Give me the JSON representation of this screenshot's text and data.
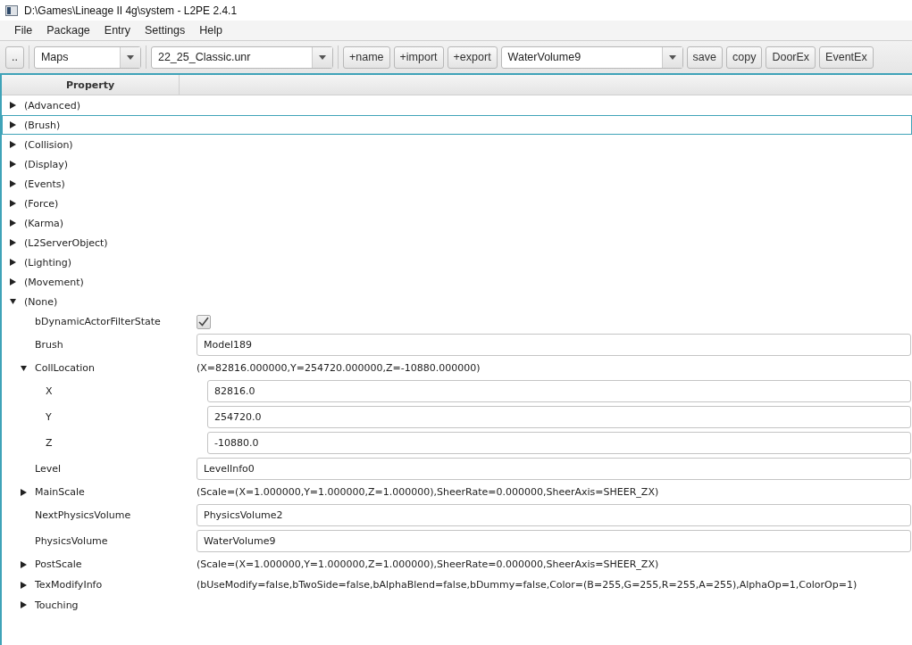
{
  "window": {
    "title": "D:\\Games\\Lineage II 4g\\system - L2PE 2.4.1"
  },
  "menu": [
    "File",
    "Package",
    "Entry",
    "Settings",
    "Help"
  ],
  "toolbar": [
    {
      "kind": "button",
      "label": ".."
    },
    {
      "kind": "separator"
    },
    {
      "kind": "combo",
      "value": "Maps"
    },
    {
      "kind": "separator"
    },
    {
      "kind": "combo",
      "value": "22_25_Classic.unr"
    },
    {
      "kind": "separator"
    },
    {
      "kind": "button",
      "label": "+name"
    },
    {
      "kind": "button",
      "label": "+import"
    },
    {
      "kind": "button",
      "label": "+export"
    },
    {
      "kind": "combo",
      "value": "WaterVolume9"
    },
    {
      "kind": "button",
      "label": "save"
    },
    {
      "kind": "button",
      "label": "copy"
    },
    {
      "kind": "button",
      "label": "DoorEx"
    },
    {
      "kind": "button",
      "label": "EventEx"
    }
  ],
  "table": {
    "columns": [
      "Property"
    ],
    "rows": [
      {
        "label": "(Advanced)",
        "kind": "group",
        "expanded": false,
        "selected": false
      },
      {
        "label": "(Brush)",
        "kind": "group",
        "expanded": false,
        "selected": true
      },
      {
        "label": "(Collision)",
        "kind": "group",
        "expanded": false,
        "selected": false
      },
      {
        "label": "(Display)",
        "kind": "group",
        "expanded": false,
        "selected": false
      },
      {
        "label": "(Events)",
        "kind": "group",
        "expanded": false,
        "selected": false
      },
      {
        "label": "(Force)",
        "kind": "group",
        "expanded": false,
        "selected": false
      },
      {
        "label": "(Karma)",
        "kind": "group",
        "expanded": false,
        "selected": false
      },
      {
        "label": "(L2ServerObject)",
        "kind": "group",
        "expanded": false,
        "selected": false
      },
      {
        "label": "(Lighting)",
        "kind": "group",
        "expanded": false,
        "selected": false
      },
      {
        "label": "(Movement)",
        "kind": "group",
        "expanded": false,
        "selected": false
      },
      {
        "label": "(None)",
        "kind": "group",
        "expanded": true,
        "selected": false,
        "children": [
          {
            "label": "bDynamicActorFilterState",
            "kind": "checkbox",
            "checked": true,
            "selected": false
          },
          {
            "label": "Brush",
            "kind": "field",
            "value": "Model189",
            "selected": false
          },
          {
            "label": "CollLocation",
            "kind": "text",
            "expanded": true,
            "value": "(X=82816.000000,Y=254720.000000,Z=-10880.000000)",
            "selected": false,
            "children": [
              {
                "label": "X",
                "kind": "field",
                "value": "82816.0",
                "selected": false
              },
              {
                "label": "Y",
                "kind": "field",
                "value": "254720.0",
                "selected": false
              },
              {
                "label": "Z",
                "kind": "field",
                "value": "-10880.0",
                "selected": false
              }
            ]
          },
          {
            "label": "Level",
            "kind": "field",
            "value": "LevelInfo0",
            "selected": false
          },
          {
            "label": "MainScale",
            "kind": "text",
            "expanded": false,
            "value": "(Scale=(X=1.000000,Y=1.000000,Z=1.000000),SheerRate=0.000000,SheerAxis=SHEER_ZX)",
            "selected": false
          },
          {
            "label": "NextPhysicsVolume",
            "kind": "field",
            "value": "PhysicsVolume2",
            "selected": false
          },
          {
            "label": "PhysicsVolume",
            "kind": "field",
            "value": "WaterVolume9",
            "selected": false
          },
          {
            "label": "PostScale",
            "kind": "text",
            "expanded": false,
            "value": "(Scale=(X=1.000000,Y=1.000000,Z=1.000000),SheerRate=0.000000,SheerAxis=SHEER_ZX)",
            "selected": false
          },
          {
            "label": "TexModifyInfo",
            "kind": "text",
            "expanded": false,
            "value": "(bUseModify=false,bTwoSide=false,bAlphaBlend=false,bDummy=false,Color=(B=255,G=255,R=255,A=255),AlphaOp=1,ColorOp=1)",
            "selected": false
          },
          {
            "label": "Touching",
            "kind": "group",
            "expanded": false,
            "selected": false
          }
        ]
      }
    ]
  }
}
